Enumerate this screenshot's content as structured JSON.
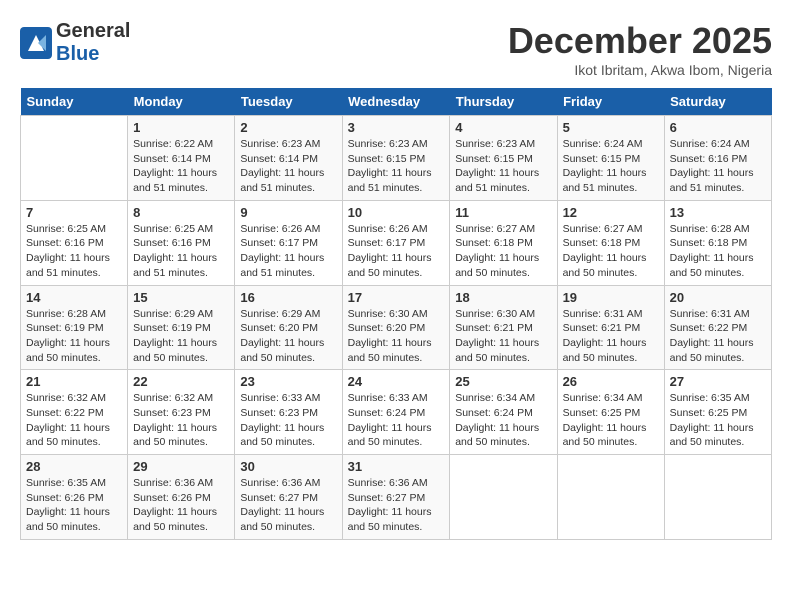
{
  "logo": {
    "text_general": "General",
    "text_blue": "Blue"
  },
  "title": "December 2025",
  "subtitle": "Ikot Ibritam, Akwa Ibom, Nigeria",
  "headers": [
    "Sunday",
    "Monday",
    "Tuesday",
    "Wednesday",
    "Thursday",
    "Friday",
    "Saturday"
  ],
  "weeks": [
    [
      {
        "day": "",
        "info": ""
      },
      {
        "day": "1",
        "info": "Sunrise: 6:22 AM\nSunset: 6:14 PM\nDaylight: 11 hours\nand 51 minutes."
      },
      {
        "day": "2",
        "info": "Sunrise: 6:23 AM\nSunset: 6:14 PM\nDaylight: 11 hours\nand 51 minutes."
      },
      {
        "day": "3",
        "info": "Sunrise: 6:23 AM\nSunset: 6:15 PM\nDaylight: 11 hours\nand 51 minutes."
      },
      {
        "day": "4",
        "info": "Sunrise: 6:23 AM\nSunset: 6:15 PM\nDaylight: 11 hours\nand 51 minutes."
      },
      {
        "day": "5",
        "info": "Sunrise: 6:24 AM\nSunset: 6:15 PM\nDaylight: 11 hours\nand 51 minutes."
      },
      {
        "day": "6",
        "info": "Sunrise: 6:24 AM\nSunset: 6:16 PM\nDaylight: 11 hours\nand 51 minutes."
      }
    ],
    [
      {
        "day": "7",
        "info": "Sunrise: 6:25 AM\nSunset: 6:16 PM\nDaylight: 11 hours\nand 51 minutes."
      },
      {
        "day": "8",
        "info": "Sunrise: 6:25 AM\nSunset: 6:16 PM\nDaylight: 11 hours\nand 51 minutes."
      },
      {
        "day": "9",
        "info": "Sunrise: 6:26 AM\nSunset: 6:17 PM\nDaylight: 11 hours\nand 51 minutes."
      },
      {
        "day": "10",
        "info": "Sunrise: 6:26 AM\nSunset: 6:17 PM\nDaylight: 11 hours\nand 50 minutes."
      },
      {
        "day": "11",
        "info": "Sunrise: 6:27 AM\nSunset: 6:18 PM\nDaylight: 11 hours\nand 50 minutes."
      },
      {
        "day": "12",
        "info": "Sunrise: 6:27 AM\nSunset: 6:18 PM\nDaylight: 11 hours\nand 50 minutes."
      },
      {
        "day": "13",
        "info": "Sunrise: 6:28 AM\nSunset: 6:18 PM\nDaylight: 11 hours\nand 50 minutes."
      }
    ],
    [
      {
        "day": "14",
        "info": "Sunrise: 6:28 AM\nSunset: 6:19 PM\nDaylight: 11 hours\nand 50 minutes."
      },
      {
        "day": "15",
        "info": "Sunrise: 6:29 AM\nSunset: 6:19 PM\nDaylight: 11 hours\nand 50 minutes."
      },
      {
        "day": "16",
        "info": "Sunrise: 6:29 AM\nSunset: 6:20 PM\nDaylight: 11 hours\nand 50 minutes."
      },
      {
        "day": "17",
        "info": "Sunrise: 6:30 AM\nSunset: 6:20 PM\nDaylight: 11 hours\nand 50 minutes."
      },
      {
        "day": "18",
        "info": "Sunrise: 6:30 AM\nSunset: 6:21 PM\nDaylight: 11 hours\nand 50 minutes."
      },
      {
        "day": "19",
        "info": "Sunrise: 6:31 AM\nSunset: 6:21 PM\nDaylight: 11 hours\nand 50 minutes."
      },
      {
        "day": "20",
        "info": "Sunrise: 6:31 AM\nSunset: 6:22 PM\nDaylight: 11 hours\nand 50 minutes."
      }
    ],
    [
      {
        "day": "21",
        "info": "Sunrise: 6:32 AM\nSunset: 6:22 PM\nDaylight: 11 hours\nand 50 minutes."
      },
      {
        "day": "22",
        "info": "Sunrise: 6:32 AM\nSunset: 6:23 PM\nDaylight: 11 hours\nand 50 minutes."
      },
      {
        "day": "23",
        "info": "Sunrise: 6:33 AM\nSunset: 6:23 PM\nDaylight: 11 hours\nand 50 minutes."
      },
      {
        "day": "24",
        "info": "Sunrise: 6:33 AM\nSunset: 6:24 PM\nDaylight: 11 hours\nand 50 minutes."
      },
      {
        "day": "25",
        "info": "Sunrise: 6:34 AM\nSunset: 6:24 PM\nDaylight: 11 hours\nand 50 minutes."
      },
      {
        "day": "26",
        "info": "Sunrise: 6:34 AM\nSunset: 6:25 PM\nDaylight: 11 hours\nand 50 minutes."
      },
      {
        "day": "27",
        "info": "Sunrise: 6:35 AM\nSunset: 6:25 PM\nDaylight: 11 hours\nand 50 minutes."
      }
    ],
    [
      {
        "day": "28",
        "info": "Sunrise: 6:35 AM\nSunset: 6:26 PM\nDaylight: 11 hours\nand 50 minutes."
      },
      {
        "day": "29",
        "info": "Sunrise: 6:36 AM\nSunset: 6:26 PM\nDaylight: 11 hours\nand 50 minutes."
      },
      {
        "day": "30",
        "info": "Sunrise: 6:36 AM\nSunset: 6:27 PM\nDaylight: 11 hours\nand 50 minutes."
      },
      {
        "day": "31",
        "info": "Sunrise: 6:36 AM\nSunset: 6:27 PM\nDaylight: 11 hours\nand 50 minutes."
      },
      {
        "day": "",
        "info": ""
      },
      {
        "day": "",
        "info": ""
      },
      {
        "day": "",
        "info": ""
      }
    ]
  ]
}
